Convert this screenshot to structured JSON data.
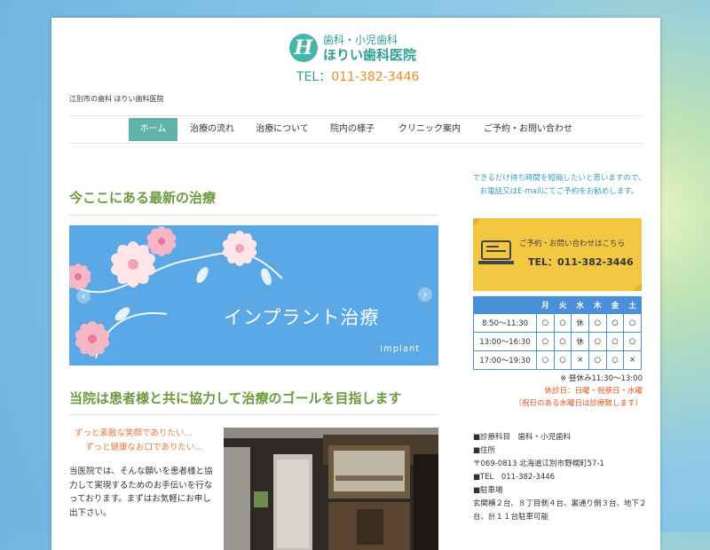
{
  "header": {
    "logo_mark": "H",
    "logo_sub": "歯科・小児歯科",
    "logo_main": "ほりい歯科医院",
    "tel_prefix": "TEL：",
    "tel_number": "011-382-3446",
    "tagline": "江別市の歯科 ほりい歯科医院"
  },
  "nav": {
    "items": [
      {
        "label": "ホーム",
        "active": true
      },
      {
        "label": "治療の流れ"
      },
      {
        "label": "治療について"
      },
      {
        "label": "院内の様子"
      },
      {
        "label": "クリニック案内"
      },
      {
        "label": "ご予約・お問い合わせ"
      }
    ]
  },
  "main": {
    "section1_title": "今ここにある最新の治療",
    "slider": {
      "title": "インプラント治療",
      "subtitle": "Implant",
      "prev": "‹",
      "next": "›"
    },
    "section2_title": "当院は患者様と共に協力して治療のゴールを目指します",
    "catch1": "ずっと素敵な笑顔でありたい…",
    "catch2": "ずっと健康なお口でありたい…",
    "body": "当医院では、そんな願いを患者様と協力して実現するためのお手伝いを行なっております。まずはお気軽にお申し出下さい。"
  },
  "sidebar": {
    "intro": "できるだけ待ち時間を短縮したいと思いますので、お電話又はE-mailにてご予約をお勧めします。",
    "banner_line1": "ご予約・お問い合わせはこちら",
    "banner_line2": "TEL：011-382-3446",
    "schedule": {
      "headers": [
        "",
        "月",
        "火",
        "水",
        "木",
        "金",
        "土"
      ],
      "rows": [
        [
          "8:50〜11:30",
          "○",
          "○",
          "休",
          "○",
          "○",
          "○"
        ],
        [
          "13:00〜16:30",
          "○",
          "○",
          "休",
          "○",
          "○",
          "○"
        ],
        [
          "17:00〜19:30",
          "○",
          "○",
          "×",
          "○",
          "○",
          "×"
        ]
      ]
    },
    "note_lunch": "※ 昼休み11:30〜13:00",
    "note_closed": "休診日：日曜・祝祭日・水曜",
    "note_holiday": "（祝日のある水曜日は診療致します）",
    "info": {
      "dept": "■診療科目　歯科・小児歯科",
      "addr_label": "■住所",
      "addr": "〒069-0813 北海道江別市野幌町57-1",
      "tel": "■TEL　011-382-3446",
      "parking_label": "■駐車場",
      "parking": "玄関横２台、８丁目側４台、裏通り側３台、地下２台、計１１台駐車可能"
    }
  },
  "colors": {
    "accent_green": "#6a9b3d",
    "nav_active": "#5fb3a8",
    "tel_orange": "#f08a24",
    "schedule_blue": "#4a90d9",
    "banner_yellow": "#f2c843",
    "notice_red": "#e0531e"
  }
}
